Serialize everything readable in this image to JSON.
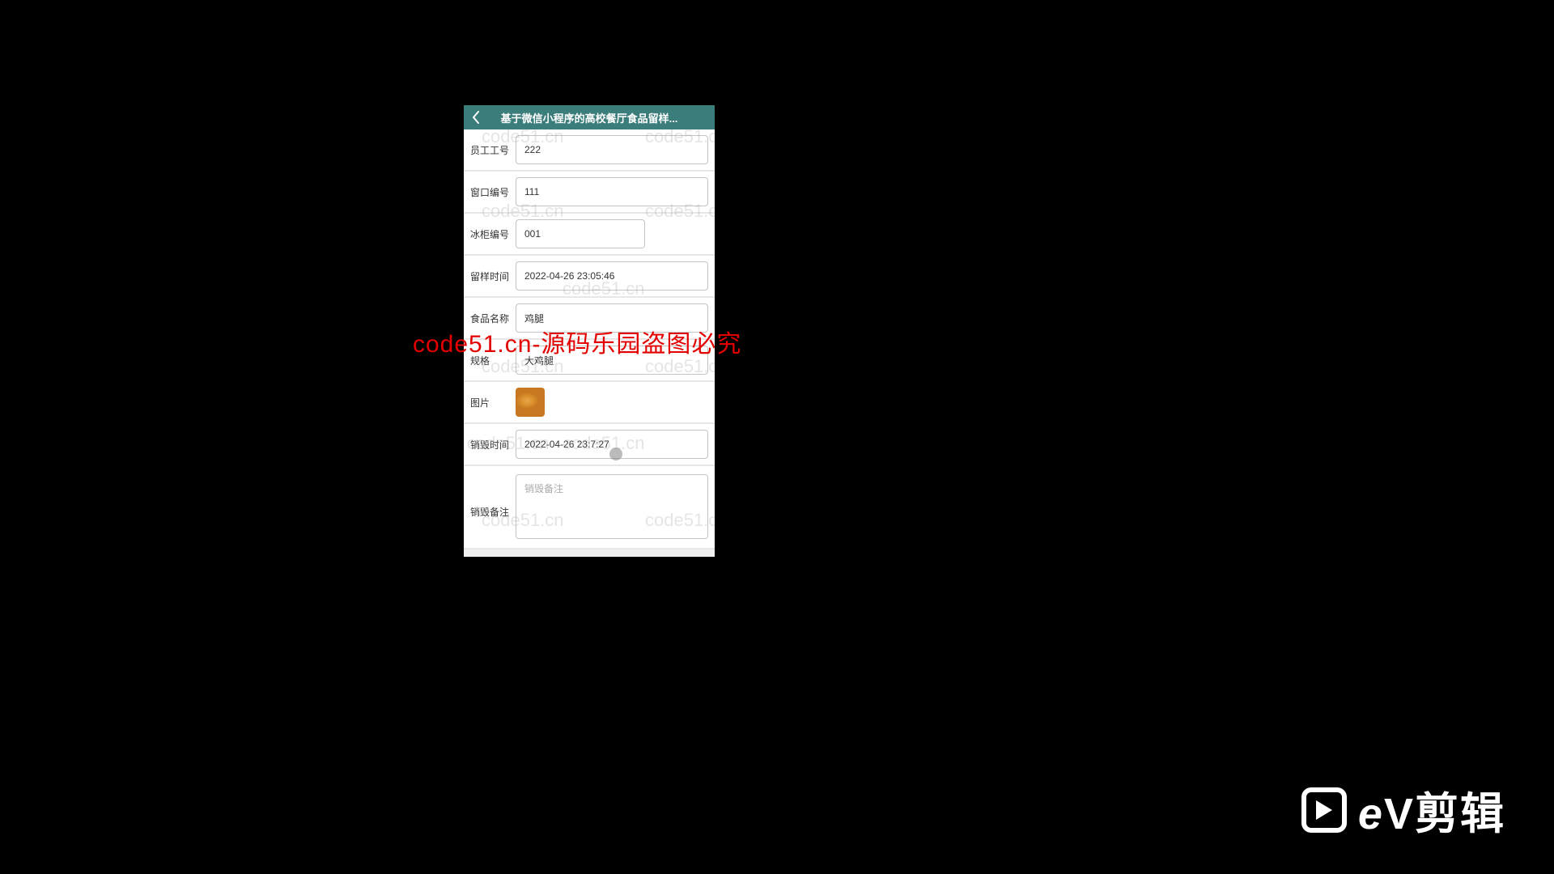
{
  "header": {
    "title": "基于微信小程序的高校餐厅食品留样..."
  },
  "fields": {
    "employee_id": {
      "label": "员工工号",
      "value": "222"
    },
    "window_no": {
      "label": "窗口编号",
      "value": "111"
    },
    "freezer_no": {
      "label": "冰柜编号",
      "value": "001"
    },
    "sample_time": {
      "label": "留样时间",
      "value": "2022-04-26 23:05:46"
    },
    "food_name": {
      "label": "食品名称",
      "value": "鸡腿"
    },
    "spec": {
      "label": "规格",
      "value": "大鸡腿"
    },
    "image": {
      "label": "图片"
    },
    "destroy_time": {
      "label": "销毁时间",
      "value": "2022-04-26 23:7:27"
    },
    "destroy_note": {
      "label": "销毁备注",
      "placeholder": "销毁备注",
      "value": ""
    }
  },
  "watermark_text": "code51.cn",
  "overlay_text": "code51.cn-源码乐园盗图必究",
  "brand": {
    "name": "ev剪辑"
  }
}
